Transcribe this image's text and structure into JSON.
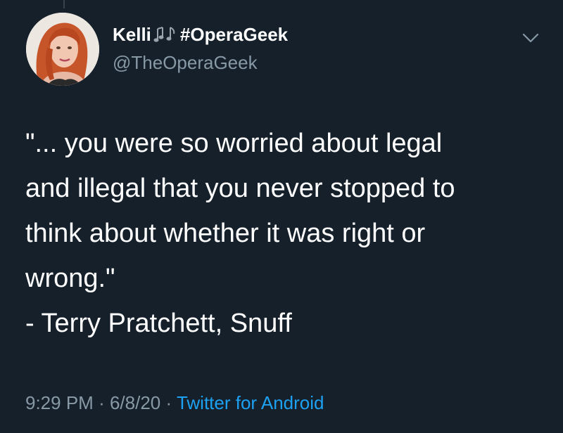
{
  "tweet": {
    "author": {
      "name": "Kelli",
      "name_suffix": "#OperaGeek",
      "name_emoji_icon": "musical-notes-icon",
      "handle": "@TheOperaGeek",
      "avatar_icon": "profile-photo"
    },
    "menu_icon": "chevron-down-icon",
    "text_lines": [
      "\"... you were so worried about legal",
      "and illegal that you never stopped to",
      "think about whether it was right or",
      "wrong.\"",
      "- Terry Pratchett, Snuff"
    ],
    "time": "9:29 PM",
    "separator": "·",
    "date": "6/8/20",
    "source": "Twitter for Android"
  },
  "colors": {
    "background": "#15202b",
    "primary_text": "#ffffff",
    "secondary_text": "#8899a6",
    "link": "#1da1f2"
  }
}
